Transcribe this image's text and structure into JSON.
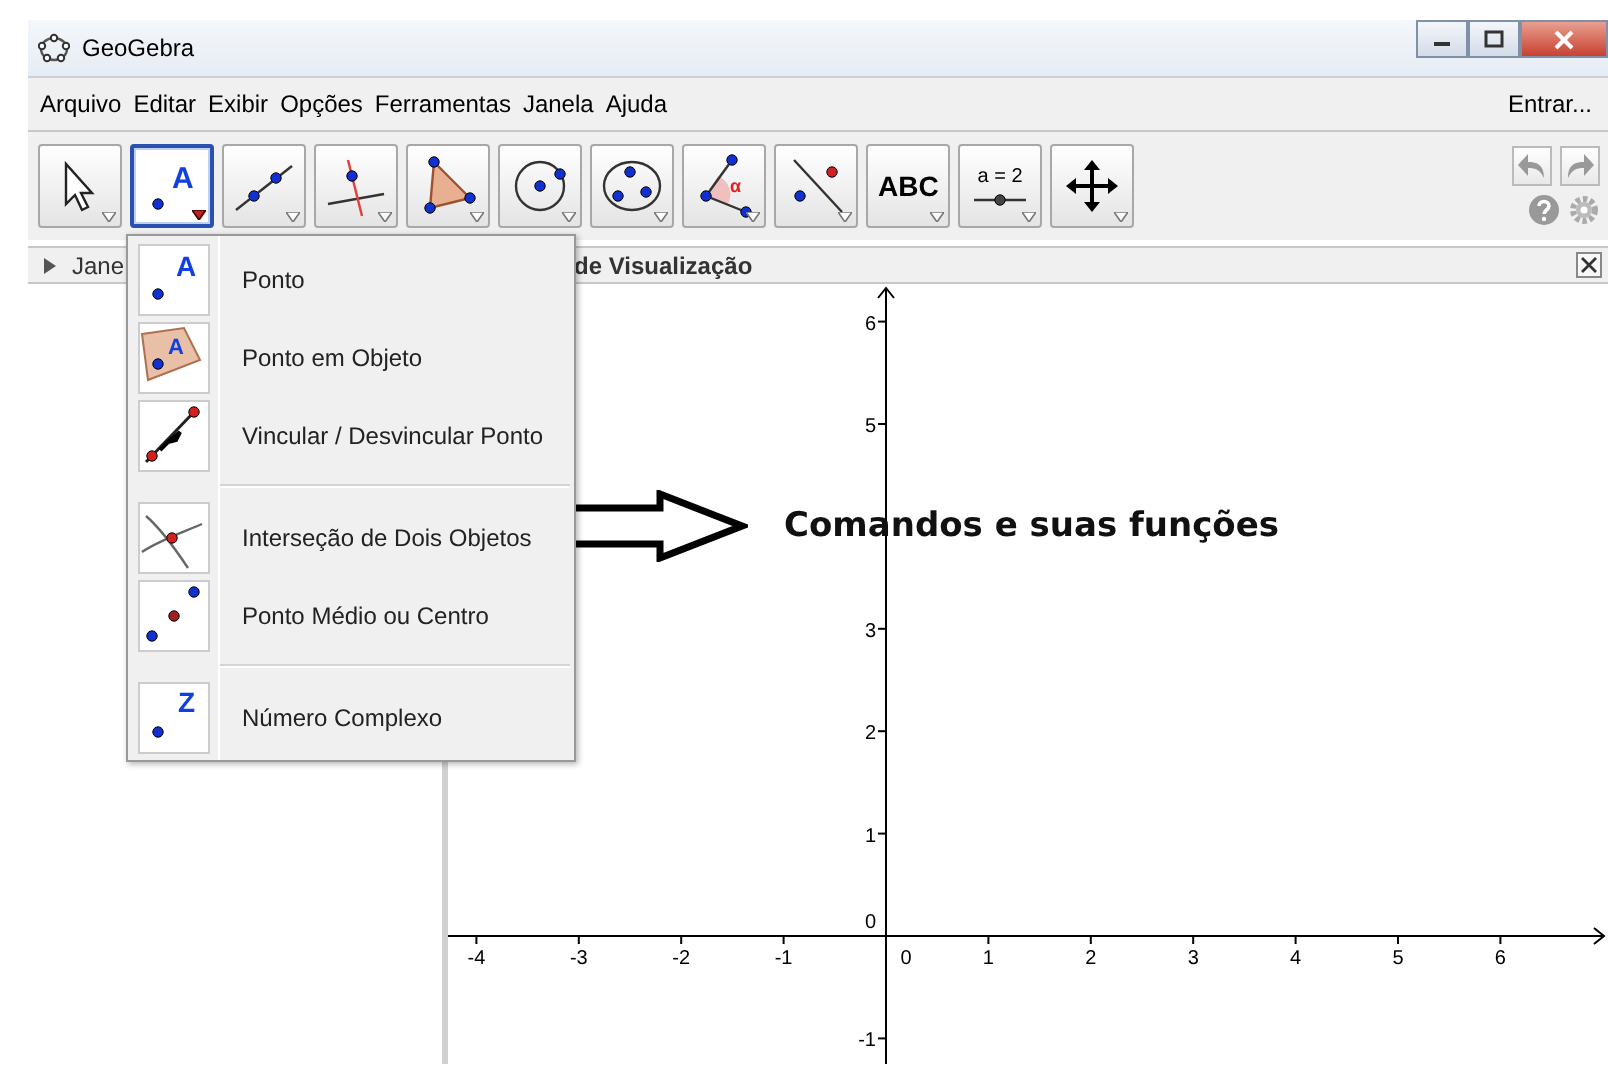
{
  "window": {
    "title": "GeoGebra"
  },
  "menu_bar": {
    "items": [
      "Arquivo",
      "Editar",
      "Exibir",
      "Opções",
      "Ferramentas",
      "Janela",
      "Ajuda"
    ],
    "sign_in": "Entrar..."
  },
  "toolbar": {
    "tools": [
      {
        "kind": "move",
        "selected": false
      },
      {
        "kind": "point",
        "label": "A",
        "selected": true
      },
      {
        "kind": "line",
        "selected": false
      },
      {
        "kind": "perpendicular",
        "selected": false
      },
      {
        "kind": "polygon",
        "selected": false
      },
      {
        "kind": "circle",
        "selected": false
      },
      {
        "kind": "conic",
        "selected": false
      },
      {
        "kind": "angle",
        "label": "α",
        "selected": false
      },
      {
        "kind": "reflect",
        "selected": false
      },
      {
        "kind": "text",
        "label": "ABC",
        "selected": false
      },
      {
        "kind": "slider",
        "label": "a = 2",
        "selected": false
      },
      {
        "kind": "move-view",
        "selected": false
      }
    ]
  },
  "algebra_panel": {
    "title": "Jane"
  },
  "graphics_panel": {
    "title": "de Visualização",
    "x_ticks": [
      "-4",
      "-3",
      "-2",
      "-1",
      "0",
      "1",
      "2",
      "3",
      "4",
      "5",
      "6"
    ],
    "y_ticks_upper": [
      "6",
      "5"
    ],
    "y_ticks_lower": [
      "3",
      "2",
      "1",
      "0",
      "-1"
    ]
  },
  "tool_menu": {
    "groups": [
      [
        {
          "kind": "point",
          "icon_label": "A",
          "label": "Ponto"
        },
        {
          "kind": "point-on-object",
          "icon_label": "A",
          "label": "Ponto em Objeto"
        },
        {
          "kind": "attach",
          "label": "Vincular / Desvincular Ponto"
        }
      ],
      [
        {
          "kind": "intersect",
          "label": "Interseção de Dois Objetos"
        },
        {
          "kind": "midpoint",
          "label": "Ponto Médio ou Centro"
        }
      ],
      [
        {
          "kind": "complex",
          "icon_label": "Z",
          "label": "Número Complexo"
        }
      ]
    ]
  },
  "annotation": {
    "text": "Comandos e suas funções"
  }
}
